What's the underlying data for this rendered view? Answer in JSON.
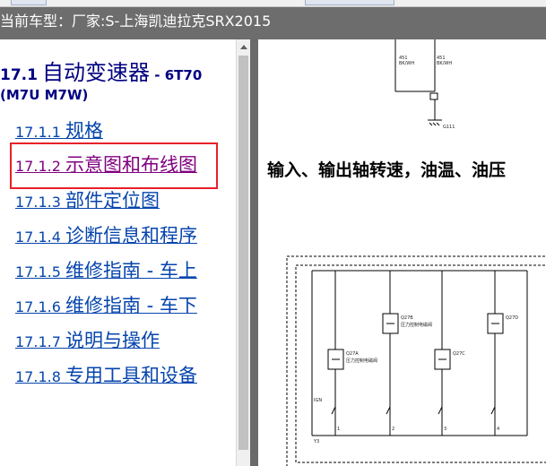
{
  "header": {
    "title": "当前车型：厂家:S-上海凯迪拉克SRX2015"
  },
  "nav": {
    "heading_number": "17.1",
    "heading_title": "自动变速器",
    "heading_suffix": " - 6T70",
    "heading_subtitle": "(M7U M7W)",
    "items": [
      {
        "number": "17.1.1 ",
        "label": "规格"
      },
      {
        "number": "17.1.2 ",
        "label": "示意图和布线图"
      },
      {
        "number": "17.1.3 ",
        "label": "部件定位图"
      },
      {
        "number": "17.1.4 ",
        "label": "诊断信息和程序"
      },
      {
        "number": "17.1.5 ",
        "label": "维修指南 - 车上"
      },
      {
        "number": "17.1.6 ",
        "label": "维修指南 - 车下"
      },
      {
        "number": "17.1.7 ",
        "label": "说明与操作"
      },
      {
        "number": "17.1.8 ",
        "label": "专用工具和设备"
      }
    ]
  },
  "content": {
    "section_heading": "输入、输出轴转速，油温、油压",
    "diagram_top": {
      "wire_labels": [
        "451",
        "BK/WH",
        "451",
        "BK/WH"
      ],
      "ground_label": "G111"
    },
    "diagram_main": {
      "ign_label": "IGN",
      "solenoid_labels": [
        "Q27A",
        "Q27B",
        "Q27C",
        "Q27D",
        "Q27E"
      ],
      "solenoid_sub": "压力控制电磁阀",
      "pin_labels": [
        "1",
        "2",
        "3",
        "4",
        "5"
      ],
      "module_label": "Y3",
      "module_sub": "变速器控制模块"
    }
  }
}
